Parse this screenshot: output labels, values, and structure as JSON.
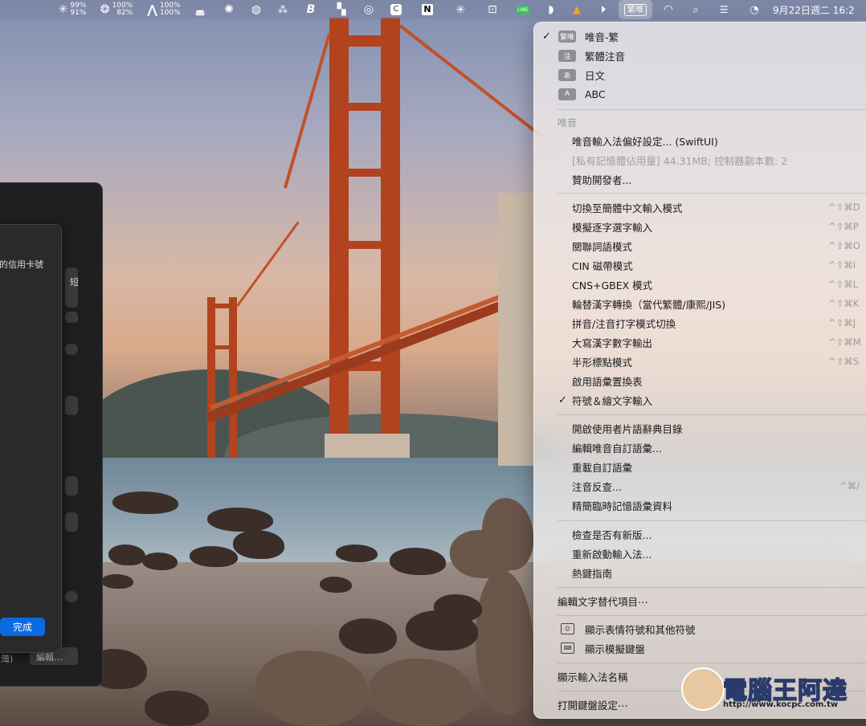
{
  "menubar": {
    "cpu": {
      "top": "99%",
      "bottom": "91%"
    },
    "mem": {
      "top": "100%",
      "bottom": "82%"
    },
    "net": {
      "top": "100%",
      "bottom": "100%"
    },
    "line_badge": "LINE",
    "ime_indicator": "繁唯",
    "datetime": "9月22日週二 16:2"
  },
  "left_window": {
    "card_text": "的信用卡號",
    "short_text": "短",
    "done_label": "完成",
    "bottom_left": "灣)",
    "edit_label": "編輯…"
  },
  "menu": {
    "input_sources": [
      {
        "badge": "繁唯",
        "label": "唯音-繁",
        "checked": true
      },
      {
        "badge": "注",
        "label": "繁體注音",
        "checked": false
      },
      {
        "badge": "あ",
        "label": "日文",
        "checked": false
      },
      {
        "badge": "A",
        "label": "ABC",
        "checked": false
      }
    ],
    "section_header": "唯音",
    "prefs": "唯音輸入法偏好設定... (SwiftUI)",
    "memory_info": "[私有記憶體佔用量] 44.31MB; 控制器副本數: 2",
    "sponsor": "贊助開發者...",
    "modes": [
      {
        "label": "切換至簡體中文輸入模式",
        "shortcut": "^⇧⌘D",
        "checked": false
      },
      {
        "label": "模擬逐字選字輸入",
        "shortcut": "^⇧⌘P",
        "checked": false
      },
      {
        "label": "關聯詞語模式",
        "shortcut": "^⇧⌘O",
        "checked": false
      },
      {
        "label": "CIN 磁帶模式",
        "shortcut": "^⇧⌘I",
        "checked": false
      },
      {
        "label": "CNS+GBEX 模式",
        "shortcut": "^⇧⌘L",
        "checked": false
      },
      {
        "label": "輪替漢字轉換（當代繁體/康熙/JIS)",
        "shortcut": "^⇧⌘K",
        "checked": false
      },
      {
        "label": "拼音/注音打字模式切換",
        "shortcut": "^⇧⌘J",
        "checked": false
      },
      {
        "label": "大寫漢字數字輸出",
        "shortcut": "^⇧⌘M",
        "checked": false
      },
      {
        "label": "半形標點模式",
        "shortcut": "^⇧⌘S",
        "checked": false
      },
      {
        "label": "啟用語彙置換表",
        "shortcut": "",
        "checked": false
      },
      {
        "label": "符號＆繪文字輸入",
        "shortcut": "",
        "checked": true
      }
    ],
    "user_tools": [
      {
        "label": "開啟使用者片語辭典目錄",
        "shortcut": ""
      },
      {
        "label": "編輯唯音自訂語彙...",
        "shortcut": ""
      },
      {
        "label": "重載自訂語彙",
        "shortcut": ""
      },
      {
        "label": "注音反查...",
        "shortcut": "^⌘/"
      },
      {
        "label": "精簡臨時記憶語彙資料",
        "shortcut": ""
      }
    ],
    "app_tools": [
      {
        "label": "檢查是否有新版..."
      },
      {
        "label": "重新啟動輸入法..."
      },
      {
        "label": "熱鍵指南"
      }
    ],
    "edit_text_replacement": "編輯文字替代項目⋯",
    "show_emoji": "顯示表情符號和其他符號",
    "show_keyboard": "顯示模擬鍵盤",
    "show_input_name": "顯示輸入法名稱",
    "open_keyboard_settings": "打開鍵盤設定⋯"
  },
  "watermark": {
    "brand": "電腦王阿達",
    "url": "http://www.kocpc.com.tw"
  },
  "icons": [
    "cpu-icon",
    "memory-icon",
    "network-icon",
    "app-icon",
    "chatgpt-icon",
    "vpn-icon",
    "dropbox-icon",
    "bear-icon",
    "grid-icon",
    "radar-icon",
    "clipboard-icon",
    "notion-icon",
    "star-icon",
    "screenshot-icon",
    "line-icon",
    "airplay-icon",
    "vlc-icon",
    "play-icon",
    "ime-indicator",
    "wifi-icon",
    "search-icon",
    "control-center-icon",
    "timemachine-icon"
  ]
}
